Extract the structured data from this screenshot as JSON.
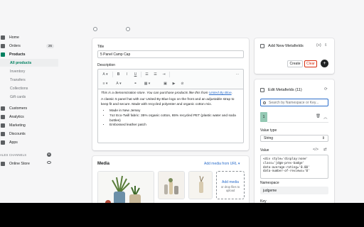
{
  "sidebar": {
    "items": [
      {
        "label": "Home",
        "icon": "home-icon"
      },
      {
        "label": "Orders",
        "icon": "orders-icon",
        "badge": "26"
      },
      {
        "label": "Products",
        "icon": "tag-icon"
      },
      {
        "label": "All products"
      },
      {
        "label": "Inventory"
      },
      {
        "label": "Transfers"
      },
      {
        "label": "Collections"
      },
      {
        "label": "Gift cards"
      },
      {
        "label": "Customers",
        "icon": "person-icon"
      },
      {
        "label": "Analytics",
        "icon": "bar-chart-icon"
      },
      {
        "label": "Marketing",
        "icon": "target-icon"
      },
      {
        "label": "Discounts",
        "icon": "discount-icon"
      },
      {
        "label": "Apps",
        "icon": "apps-icon"
      }
    ],
    "sales_channels_title": "ALES CHANNELS",
    "online_store_label": "Online Store"
  },
  "product": {
    "title_label": "Title",
    "title_value": "5 Panel Camp Cap",
    "description_label": "Description",
    "description": {
      "intro": "This is a demonstration store. You can purchase products like this from ",
      "intro_link": "United By Blue",
      "intro_end": ".",
      "body": "A classic 5 panel hat with our United By Blue logo on the front and an adjustable strap to keep fit and secure. Made with recycled polyester and organic cotton mix.",
      "bullets": [
        "Made in New Jersey",
        "7oz Eco-Twill fabric: 35% organic cotton, 65% recycled PET (plastic water and soda bottles)",
        "Embossed leather patch"
      ]
    },
    "toolbar": {
      "text_style": "A",
      "bold": "B",
      "italic": "I",
      "underline": "U",
      "more": "···"
    }
  },
  "media": {
    "title": "Media",
    "add_from_url": "Add media from URL",
    "dropzone_add": "Add media",
    "dropzone_hint": "or drop files to upload"
  },
  "metafields_add": {
    "title": "Add New Metafields",
    "create_label": "Create",
    "clear_label": "Clear",
    "plus": "+"
  },
  "metafields_edit": {
    "title": "Edit Metafields (11)",
    "search_placeholder": "Search by Namespace or Key...",
    "row_index": "1",
    "value_type_label": "Value type",
    "value_type_selected": "String",
    "value_label": "Value",
    "value_code": [
      "<div style='display:none'",
      "class='jdgm-prev-badge'",
      "data-average-rating='0.00'",
      "data-number-of-reviews='0'"
    ],
    "namespace_label": "Namespace",
    "namespace_value": "judgeme",
    "key_label": "Key"
  },
  "colors": {
    "accent": "#008060",
    "link": "#2c6ecb",
    "danger": "#d72c0d",
    "row_highlight": "#95c9b4"
  }
}
